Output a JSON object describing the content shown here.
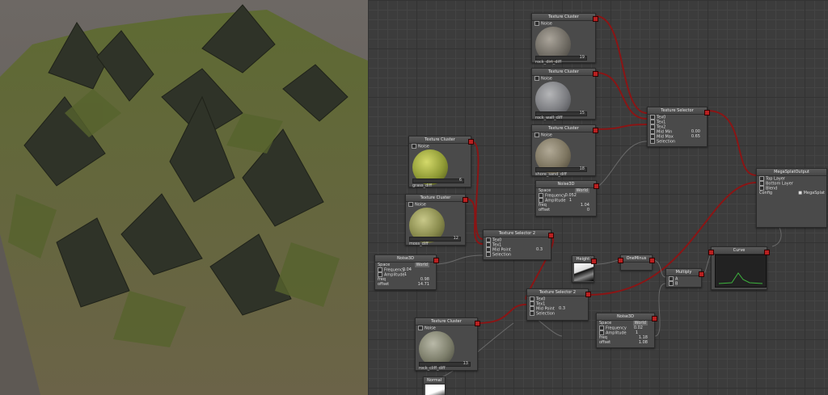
{
  "colors": {
    "wire_red": "#8a1515",
    "wire_gray": "#6a6a6a",
    "port": "#b82020"
  },
  "texture_clusters": [
    {
      "title": "Texture Cluster",
      "noise": "Noise",
      "file": "rock_dirt_diff",
      "index": "19",
      "thumb": "rock"
    },
    {
      "title": "Texture Cluster",
      "noise": "Noise",
      "file": "rock_wall_diff",
      "index": "15",
      "thumb": "wall"
    },
    {
      "title": "Texture Cluster",
      "noise": "Noise",
      "file": "shore_sand_diff",
      "index": "18",
      "thumb": "shore"
    },
    {
      "title": "Texture Cluster",
      "noise": "Noise",
      "file": "grass_diff",
      "index": "6",
      "thumb": "grass"
    },
    {
      "title": "Texture Cluster",
      "noise": "Noise",
      "file": "moss_diff",
      "index": "12",
      "thumb": "moss"
    },
    {
      "title": "Texture Cluster",
      "noise": "Noise",
      "file": "rock_cliff_diff",
      "index": "13",
      "thumb": "cliff"
    }
  ],
  "texture_selector": {
    "title": "Texture Selector",
    "tex0": "Tex0",
    "tex1": "Tex1",
    "tex2": "Tex2",
    "mid_min": "Mid Min",
    "mid_min_val": "0.00",
    "mid_max": "Mid Max",
    "mid_max_val": "0.65",
    "selection": "Selection"
  },
  "selector2_a": {
    "title": "Texture Selector 2",
    "tex0": "Tex0",
    "tex1": "Tex1",
    "mid_point": "Mid Point",
    "mid_point_val": "0.3",
    "selection": "Selection"
  },
  "selector2_b": {
    "title": "Texture Selector 2",
    "tex0": "Tex0",
    "tex1": "Tex1",
    "mid_point": "Mid Point",
    "mid_point_val": "0.3",
    "selection": "Selection"
  },
  "noise_a": {
    "title": "Noise3D",
    "space": "Space",
    "space_val": "World",
    "frequency": "Frequency",
    "frequency_val": "0.052",
    "amplitude": "Amplitude",
    "amplitude_val": "1",
    "freq": "freq",
    "freq_val": "1.04",
    "offset": "offset",
    "offset_val": "0"
  },
  "noise_b": {
    "title": "Noise3D",
    "space": "Space",
    "space_val": "World",
    "frequency": "Frequency",
    "frequency_val": "0.04",
    "amplitude": "Amplitude",
    "amplitude_val": "1",
    "freq": "freq",
    "freq_val": "0.98",
    "offset": "offset",
    "offset_val": "14.71"
  },
  "noise_c": {
    "title": "Noise3D",
    "space": "Space",
    "space_val": "World",
    "frequency": "Frequency",
    "frequency_val": "0.02",
    "amplitude": "Amplitude",
    "amplitude_val": "1",
    "freq": "freq",
    "freq_val": "1.18",
    "offset": "offset",
    "offset_val": "1.08"
  },
  "output": {
    "title": "MegaSplatOutput",
    "top": "Top Layer",
    "bottom": "Bottom Layer",
    "blend": "Blend",
    "config": "Config",
    "config_val": "MegaSplat"
  },
  "height": {
    "title": "Height"
  },
  "one_minus": {
    "title": "OneMinus"
  },
  "multiply": {
    "title": "Multiply",
    "a": "A",
    "b": "B"
  },
  "curve": {
    "title": "Curve"
  },
  "normal": {
    "title": "Normal"
  }
}
